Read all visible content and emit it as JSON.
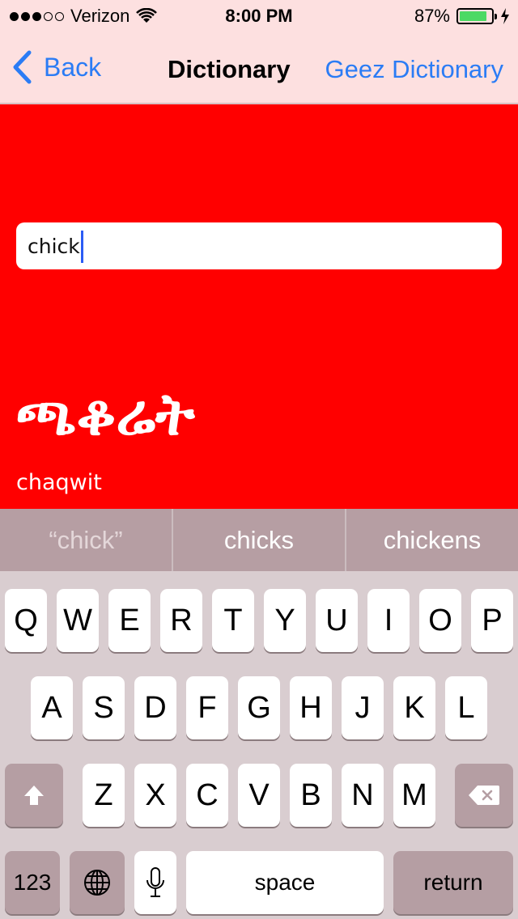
{
  "status": {
    "carrier": "Verizon",
    "time": "8:00 PM",
    "battery": "87%",
    "battery_level": 0.87,
    "signal_dots_filled": 3,
    "signal_dots_total": 5
  },
  "nav": {
    "back_label": "Back",
    "title": "Dictionary",
    "right_label": "Geez Dictionary"
  },
  "search": {
    "value": "chick"
  },
  "result": {
    "geez": "ጫቆሬት",
    "transliteration": "chaqwit"
  },
  "suggestions": [
    "“chick”",
    "chicks",
    "chickens"
  ],
  "keyboard": {
    "row1": [
      "Q",
      "W",
      "E",
      "R",
      "T",
      "Y",
      "U",
      "I",
      "O",
      "P"
    ],
    "row2": [
      "A",
      "S",
      "D",
      "F",
      "G",
      "H",
      "J",
      "K",
      "L"
    ],
    "row3": [
      "Z",
      "X",
      "C",
      "V",
      "B",
      "N",
      "M"
    ],
    "numbers_label": "123",
    "space_label": "space",
    "return_label": "return"
  }
}
